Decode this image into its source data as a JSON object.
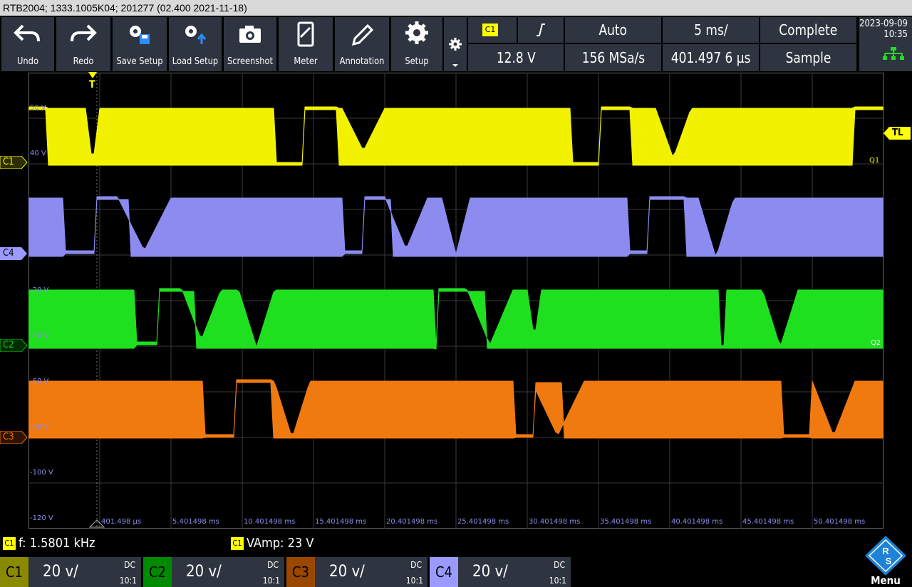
{
  "title_bar": "RTB2004; 1333.1005K04; 201277 (02.400 2021-11-18)",
  "toolbar": {
    "buttons": [
      {
        "label": "Undo",
        "icon": "undo-icon"
      },
      {
        "label": "Redo",
        "icon": "redo-icon"
      },
      {
        "label": "Save Setup",
        "icon": "save-setup-icon"
      },
      {
        "label": "Load Setup",
        "icon": "load-setup-icon"
      },
      {
        "label": "Screenshot",
        "icon": "camera-icon"
      },
      {
        "label": "Meter",
        "icon": "meter-icon"
      },
      {
        "label": "Annotation",
        "icon": "pencil-icon"
      },
      {
        "label": "Setup",
        "icon": "gear-icon"
      }
    ]
  },
  "trigger_panel": {
    "source": "C1",
    "slope": "rising",
    "mode": "Auto",
    "timebase": "5 ms/",
    "acq_state": "Complete",
    "level": "12.8 V",
    "sample_rate": "156 MSa/s",
    "position": "401.497 6 µs",
    "acq_mode": "Sample"
  },
  "datetime": {
    "date": "2023-09-09",
    "time": "10:35"
  },
  "waveform": {
    "trigger_marker": "T",
    "trigger_level_marker": "TL",
    "markers": [
      "Q1",
      "Q2"
    ],
    "y_labels": [
      "50 V",
      "40 V",
      "-20 V",
      "-40 V",
      "-60 V",
      "-80 V",
      "-100 V",
      "-120 V"
    ],
    "time_labels": [
      "401.498 µs",
      "5.401498 ms",
      "10.401498 ms",
      "15.401498 ms",
      "20.401498 ms",
      "25.401498 ms",
      "30.401498 ms",
      "35.401498 ms",
      "40.401498 ms",
      "45.401498 ms",
      "50.401498 ms"
    ],
    "channel_labels": [
      "C1",
      "C4",
      "C2",
      "C3"
    ]
  },
  "measurements": [
    {
      "source": "C1",
      "text": "f: 1.5801 kHz"
    },
    {
      "source": "C1",
      "text": "VAmp: 23 V"
    }
  ],
  "channels": [
    {
      "name": "C1",
      "scale": "20 v/",
      "coupling": "DC",
      "probe": "10:1",
      "color": "#f0f000"
    },
    {
      "name": "C2",
      "scale": "20 v/",
      "coupling": "DC",
      "probe": "10:1",
      "color": "#00c000"
    },
    {
      "name": "C3",
      "scale": "20 v/",
      "coupling": "DC",
      "probe": "10:1",
      "color": "#f07000"
    },
    {
      "name": "C4",
      "scale": "20 v/",
      "coupling": "DC",
      "probe": "10:1",
      "color": "#9a9aff"
    }
  ],
  "menu_label": "Menu",
  "colors": {
    "yellow": "#f2f200",
    "violet": "#8c8cf0",
    "green": "#1fe01f",
    "orange": "#f07a10",
    "grid": "#3c3c3c"
  }
}
